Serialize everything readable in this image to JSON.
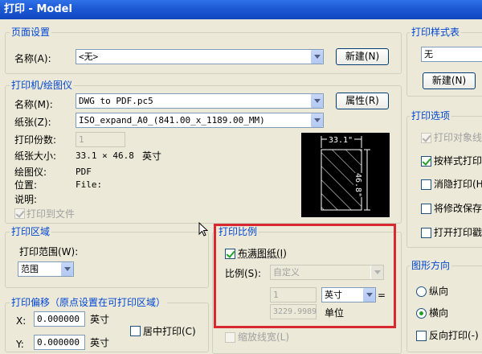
{
  "window": {
    "title": "打印 - Model"
  },
  "page_setup": {
    "title": "页面设置",
    "name_label": "名称(A):",
    "name_value": "<无>",
    "new_button": "新建(N)"
  },
  "printer": {
    "title": "打印机/绘图仪",
    "name_label": "名称(M):",
    "name_value": "DWG to PDF.pc5",
    "props_button": "属性(R)",
    "paper_label": "纸张(Z):",
    "paper_value": "ISO_expand_A0_(841.00_x_1189.00_MM)",
    "copies_label": "打印份数:",
    "copies_value": "1",
    "size_label": "纸张大小:",
    "size_value": "33.1 × 46.8",
    "size_unit": "英寸",
    "plotter_label": "绘图仪:",
    "plotter_value": "PDF",
    "location_label": "位置:",
    "location_value": "File:",
    "desc_label": "说明:",
    "print_to_file": "打印到文件",
    "preview": {
      "width_label": "33.1\"",
      "height_label": "46.8\""
    }
  },
  "plot_area": {
    "title": "打印区域",
    "range_label": "打印范围(W):",
    "range_value": "范围"
  },
  "plot_offset": {
    "title": "打印偏移（原点设置在可打印区域）",
    "x_label": "X:",
    "x_value": "0.000000",
    "x_unit": "英寸",
    "y_label": "Y:",
    "y_value": "0.000000",
    "y_unit": "英寸",
    "center_label": "居中打印(C)"
  },
  "plot_scale": {
    "title": "打印比例",
    "fit_label": "布满图纸(I)",
    "scale_label": "比例(S):",
    "scale_value": "自定义",
    "num_value": "1",
    "unit_value": "英寸",
    "equals": "=",
    "den_value": "3229.9989",
    "unit_label": "单位",
    "lineweight_label": "缩放线宽(L)"
  },
  "style_table": {
    "title": "打印样式表",
    "value": "无",
    "new_button": "新建(N)"
  },
  "options": {
    "title": "打印选项",
    "items": [
      "打印对象线",
      "按样式打印",
      "消隐打印(H",
      "将修改保存",
      "打开打印戳"
    ]
  },
  "orientation": {
    "title": "图形方向",
    "portrait": "纵向",
    "landscape": "横向",
    "reverse": "反向打印(-)"
  }
}
